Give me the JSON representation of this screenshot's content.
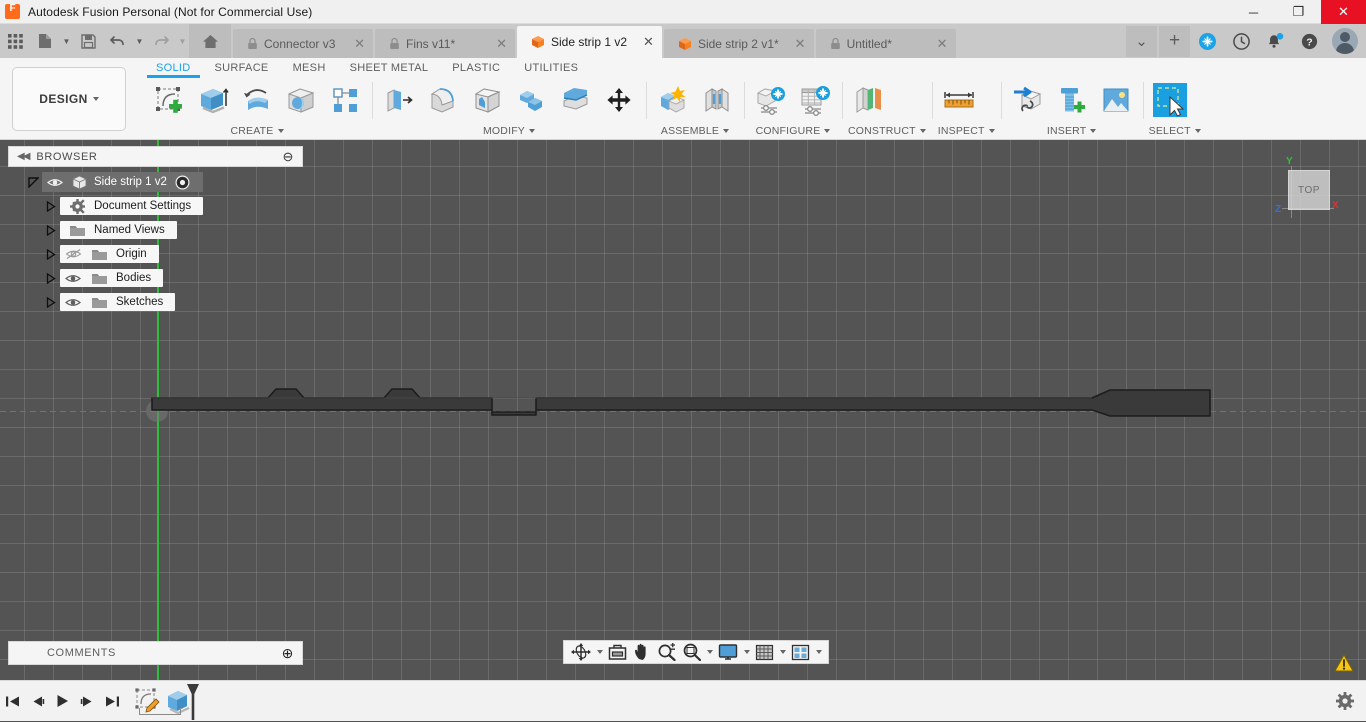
{
  "window": {
    "title": "Autodesk Fusion Personal (Not for Commercial Use)",
    "logo_letter": "F",
    "minimize": "─",
    "maximize": "❐",
    "close": "✕"
  },
  "quick_access": {
    "items": [
      {
        "name": "app-grid-icon",
        "label": ""
      },
      {
        "name": "new-file-icon",
        "label": ""
      },
      {
        "name": "save-icon",
        "label": ""
      },
      {
        "name": "undo-icon",
        "label": ""
      },
      {
        "name": "redo-icon",
        "label": ""
      }
    ],
    "home_label": ""
  },
  "tabs": [
    {
      "label": "Connector v3",
      "icon": "lock-icon",
      "active": false,
      "close": "✕"
    },
    {
      "label": "Fins v11*",
      "icon": "lock-icon",
      "active": false,
      "close": "✕"
    },
    {
      "label": "Side strip 1 v2",
      "icon": "cube-icon",
      "active": true,
      "close": "✕"
    },
    {
      "label": "Side strip 2 v1*",
      "icon": "cube-icon",
      "active": false,
      "close": "✕"
    },
    {
      "label": "Untitled*",
      "icon": "lock-icon",
      "active": false,
      "close": "✕"
    }
  ],
  "tab_overflow": "⌄",
  "tab_add": "+",
  "top_right_icons": [
    {
      "name": "extension-add-icon"
    },
    {
      "name": "recent-clock-icon"
    },
    {
      "name": "notifications-bell-icon"
    },
    {
      "name": "help-icon"
    },
    {
      "name": "account-avatar"
    }
  ],
  "ribbon": {
    "workspace": "DESIGN",
    "tabs": [
      {
        "label": "SOLID",
        "active": true
      },
      {
        "label": "SURFACE",
        "active": false
      },
      {
        "label": "MESH",
        "active": false
      },
      {
        "label": "SHEET METAL",
        "active": false
      },
      {
        "label": "PLASTIC",
        "active": false
      },
      {
        "label": "UTILITIES",
        "active": false
      }
    ],
    "groups": [
      {
        "label": "CREATE",
        "has_caret": true,
        "icons": [
          "create-sketch-icon",
          "extrude-icon",
          "revolve-icon",
          "sweep-icon",
          "pattern-icon"
        ]
      },
      {
        "label": "MODIFY",
        "has_caret": true,
        "icons": [
          "press-pull-icon",
          "fillet-icon",
          "shell-icon",
          "combine-icon",
          "offset-face-icon",
          "move-copy-icon"
        ]
      },
      {
        "label": "ASSEMBLE",
        "has_caret": true,
        "icons": [
          "new-component-icon",
          "joint-icon"
        ]
      },
      {
        "label": "CONFIGURE",
        "has_caret": true,
        "icons": [
          "configure-design-icon",
          "configuration-table-icon"
        ]
      },
      {
        "label": "CONSTRUCT",
        "has_caret": true,
        "icons": [
          "offset-plane-icon"
        ]
      },
      {
        "label": "INSPECT",
        "has_caret": true,
        "icons": [
          "measure-icon"
        ]
      },
      {
        "label": "INSERT",
        "has_caret": true,
        "icons": [
          "insert-derive-icon",
          "insert-mcmaster-icon",
          "insert-image-icon"
        ]
      },
      {
        "label": "SELECT",
        "has_caret": true,
        "icons": [
          "select-window-icon"
        ]
      }
    ]
  },
  "browser": {
    "title": "BROWSER",
    "collapse_glyph": "◀◀",
    "minus_glyph": "⊖",
    "tree": [
      {
        "label": "Side strip 1 v2",
        "level": 0,
        "selected": true,
        "visible": true,
        "icon": "component-cube-icon",
        "has_twist": true,
        "has_radio": true
      },
      {
        "label": "Document Settings",
        "level": 1,
        "selected": false,
        "visible": null,
        "icon": "gear-icon",
        "has_twist": true,
        "has_radio": false
      },
      {
        "label": "Named Views",
        "level": 1,
        "selected": false,
        "visible": null,
        "icon": "folder-icon",
        "has_twist": true,
        "has_radio": false
      },
      {
        "label": "Origin",
        "level": 1,
        "selected": false,
        "visible": false,
        "icon": "folder-icon",
        "has_twist": true,
        "has_radio": false
      },
      {
        "label": "Bodies",
        "level": 1,
        "selected": false,
        "visible": true,
        "icon": "folder-icon",
        "has_twist": true,
        "has_radio": false
      },
      {
        "label": "Sketches",
        "level": 1,
        "selected": false,
        "visible": true,
        "icon": "folder-icon",
        "has_twist": true,
        "has_radio": false
      }
    ]
  },
  "comments": {
    "title": "COMMENTS",
    "add_glyph": "⊕"
  },
  "viewcube": {
    "face_label": "TOP",
    "axis_y": "Y",
    "axis_x": "X",
    "axis_z": "Z"
  },
  "canvas": {
    "warning_icon": "warning-triangle-icon",
    "grid_color": "#545454",
    "origin_axis_y_color": "#2fbf3b",
    "origin_axis_x_color": "#cf4a4a",
    "body_fill": "#3a3a3a",
    "body_stroke": "#1d1d1d"
  },
  "navbar": {
    "items": [
      {
        "name": "orbit-icon",
        "caret": true
      },
      {
        "name": "look-at-icon",
        "caret": false
      },
      {
        "name": "pan-icon",
        "caret": false
      },
      {
        "name": "zoom-icon",
        "caret": false
      },
      {
        "name": "zoom-window-icon",
        "caret": true
      },
      {
        "name": "display-settings-icon",
        "caret": true
      },
      {
        "name": "grid-snaps-icon",
        "caret": true
      },
      {
        "name": "viewports-icon",
        "caret": true
      }
    ]
  },
  "timeline": {
    "buttons": [
      {
        "name": "go-to-beginning-button",
        "glyph": "❘◀"
      },
      {
        "name": "step-back-button",
        "glyph": "◀❘"
      },
      {
        "name": "play-button",
        "glyph": "▶"
      },
      {
        "name": "step-forward-button",
        "glyph": "❘▶"
      },
      {
        "name": "go-to-end-button",
        "glyph": "▶❘"
      }
    ],
    "features": [
      {
        "name": "timeline-sketch-feature"
      },
      {
        "name": "timeline-extrude-feature"
      }
    ]
  },
  "statusbar": {
    "settings_icon": "gear-icon"
  }
}
